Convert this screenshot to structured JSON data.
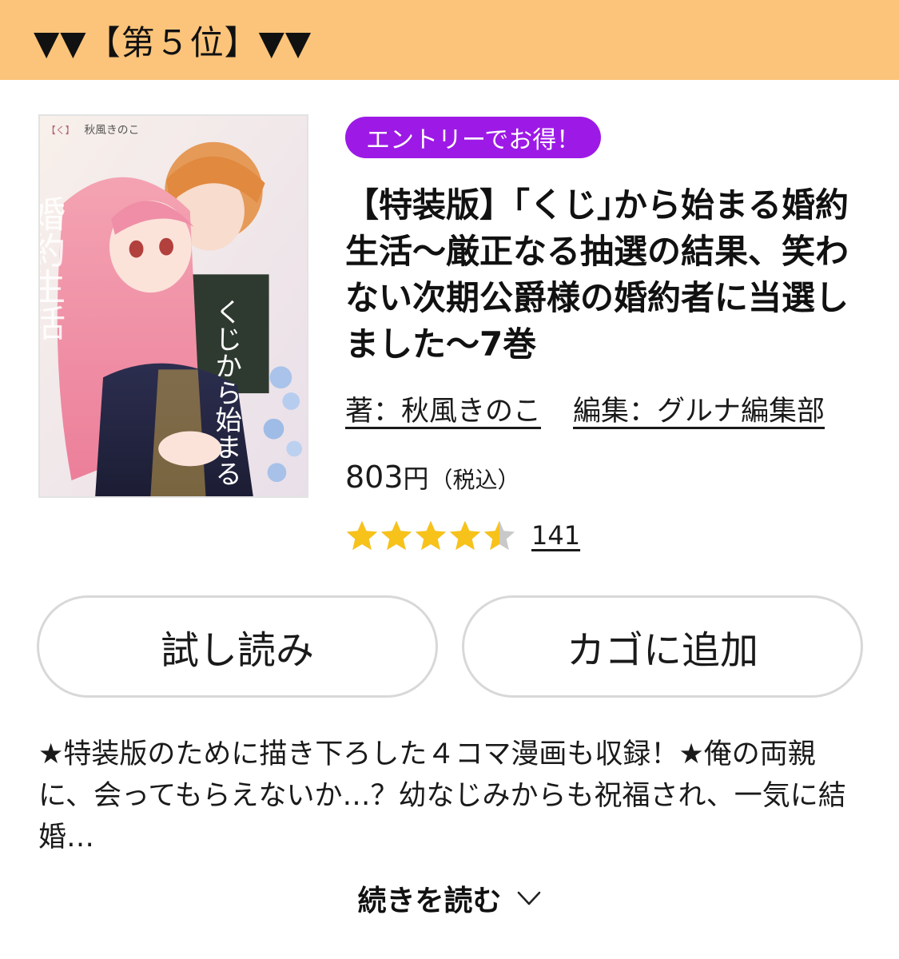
{
  "header": {
    "rank_label": "▼▼【第５位】▼▼",
    "bg_color": "#fbc47a"
  },
  "book": {
    "cover_icon": "book-cover-image",
    "cover_art_text": {
      "author": "秋風きのこ",
      "tag": "【く】",
      "vertical_title": "くじから始まる",
      "vertical_sub": "婚約生活"
    },
    "badge": "エントリーでお得！",
    "badge_color": "#9d1ae6",
    "title": "【特装版】｢くじ｣から始まる婚約生活～厳正なる抽選の結果、笑わない次期公爵様の婚約者に当選しました～7巻",
    "credits": {
      "author": "著：秋風きのこ",
      "editor": "編集：グルナ編集部"
    },
    "price": {
      "amount": "803",
      "unit": "円",
      "tax_note": "（税込）"
    },
    "rating": {
      "value": 4.5,
      "max": 5,
      "count": "141",
      "star_color": "#f7c21a",
      "empty_color": "#c9c9c9"
    }
  },
  "buttons": {
    "trial": "試し読み",
    "cart": "カゴに追加"
  },
  "description": "★特装版のために描き下ろした４コマ漫画も収録！★俺の両親に、会ってもらえないか…？幼なじみからも祝福され、一気に結婚…",
  "read_more": {
    "label": "続きを読む",
    "icon": "chevron-down-icon"
  }
}
